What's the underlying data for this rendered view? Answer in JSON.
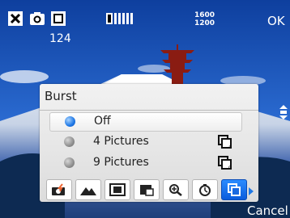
{
  "status": {
    "shots_remaining": "124",
    "resolution_top": "1600",
    "resolution_bottom": "1200",
    "ok_label": "OK"
  },
  "burst_menu": {
    "title": "Burst",
    "options": [
      {
        "label": "Off",
        "selected": true
      },
      {
        "label": "4 Pictures",
        "selected": false
      },
      {
        "label": "9 Pictures",
        "selected": false
      }
    ],
    "toolbar_icons": [
      "camera-flash-icon",
      "scene-mountain-icon",
      "frame-icon",
      "picture-in-picture-icon",
      "zoom-icon",
      "timer-icon",
      "burst-icon"
    ],
    "active_tool": "burst-icon"
  },
  "softkeys": {
    "cancel_label": "Cancel"
  },
  "colors": {
    "accent": "#1e78e6",
    "panel_bg": "#e8e8e8"
  }
}
